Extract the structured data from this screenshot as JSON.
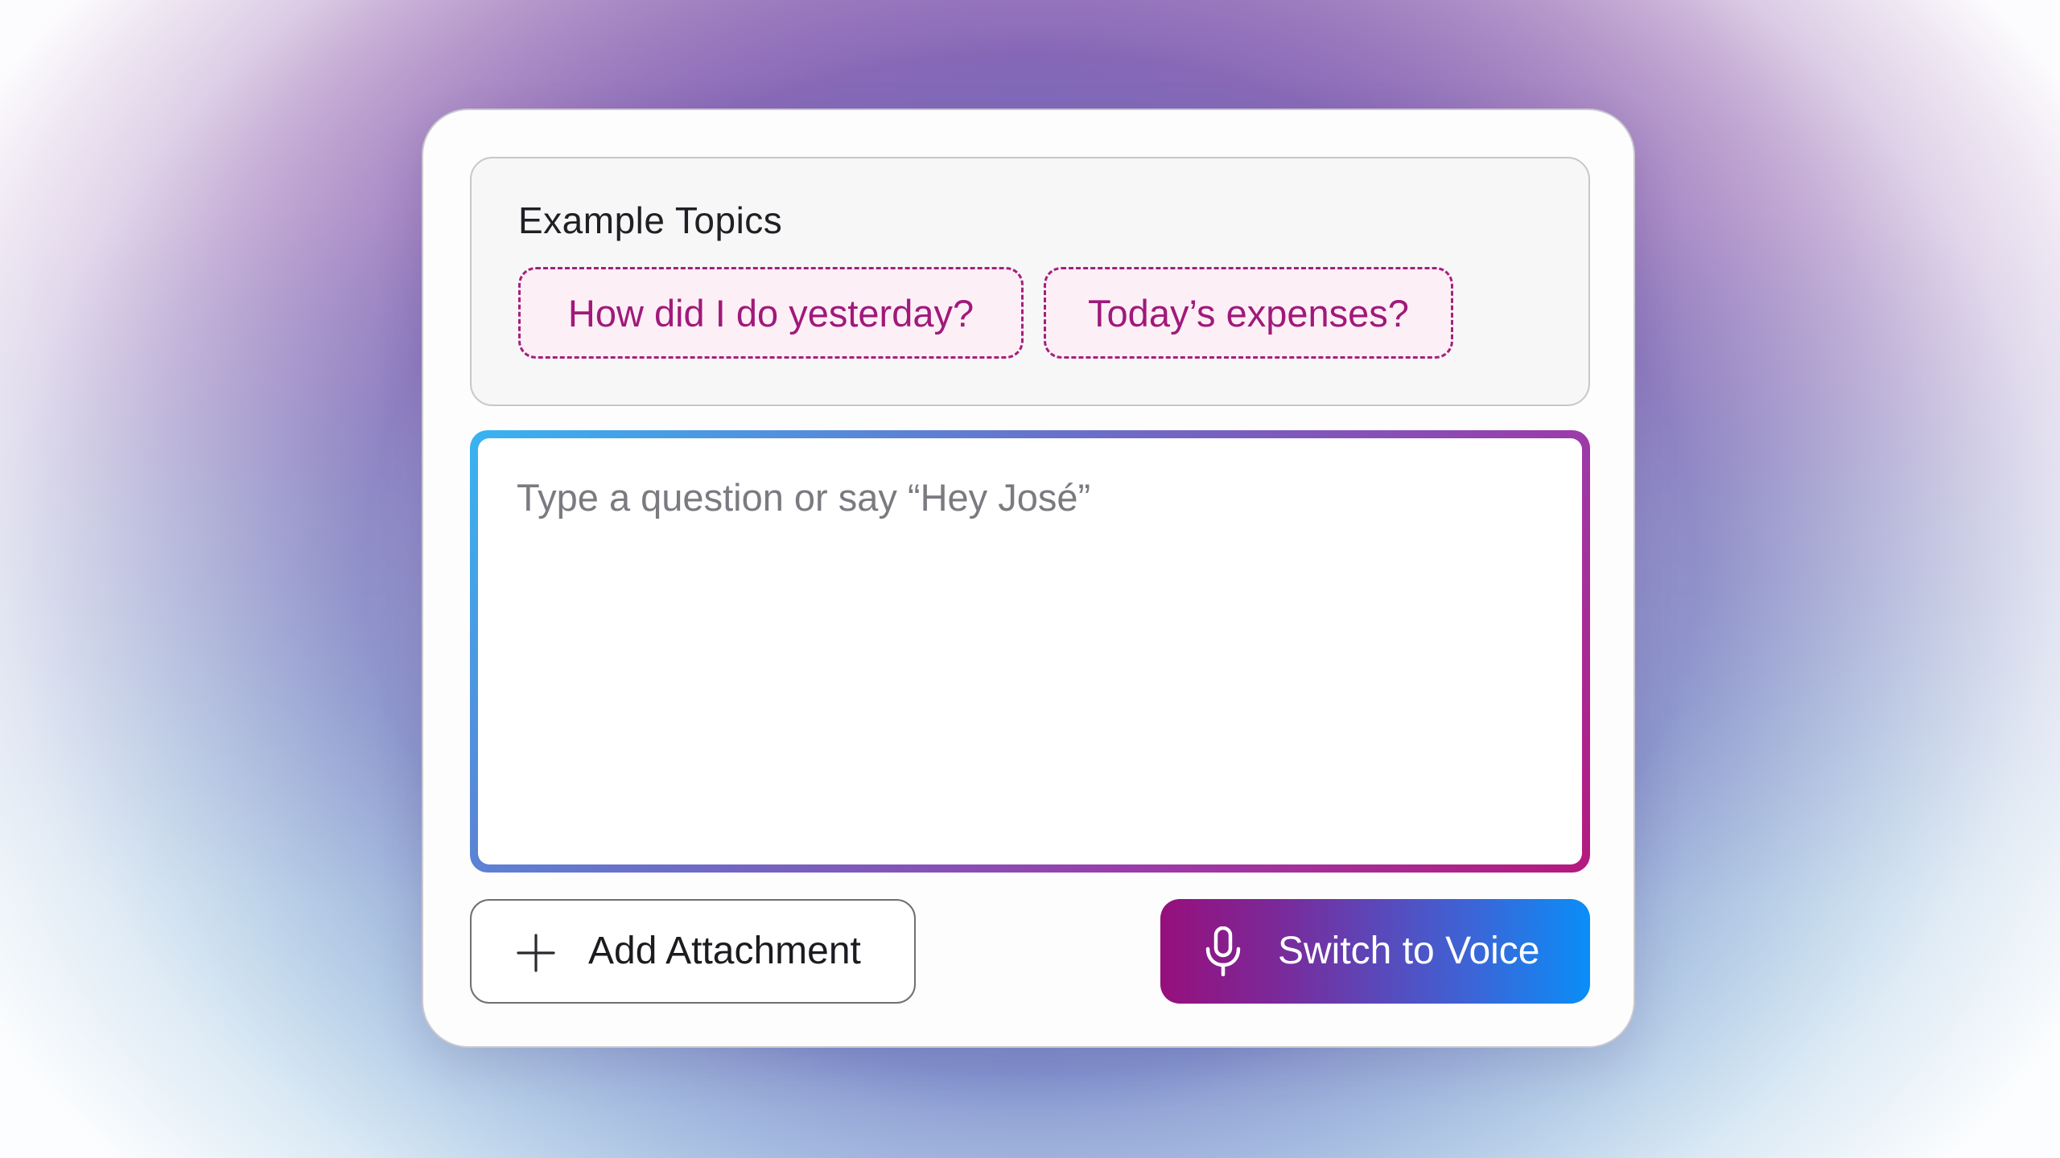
{
  "topics": {
    "title": "Example Topics",
    "chips": [
      {
        "label": "How did I do yesterday?"
      },
      {
        "label": "Today’s expenses?"
      }
    ]
  },
  "question_input": {
    "placeholder": "Type a question or say “Hey José”",
    "value": ""
  },
  "actions": {
    "add_attachment_label": "Add Attachment",
    "add_attachment_icon": "plus-icon",
    "switch_voice_label": "Switch to Voice",
    "switch_voice_icon": "microphone-icon"
  },
  "colors": {
    "accent_magenta": "#a0197a",
    "accent_blue": "#0a8ef8",
    "input_border_start": "#38b3f2",
    "input_border_end": "#b5197e"
  }
}
